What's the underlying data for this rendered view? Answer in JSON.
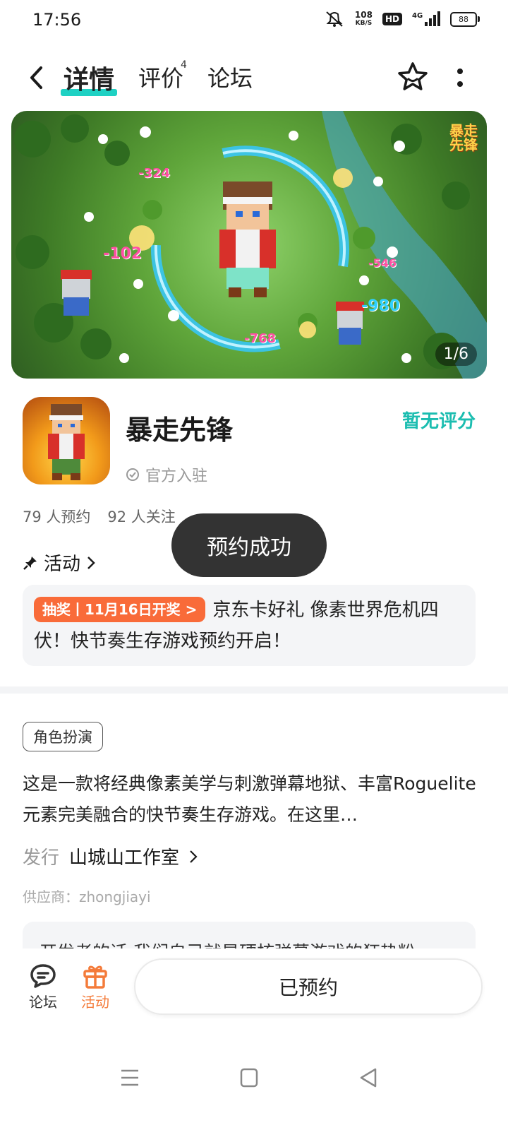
{
  "status_bar": {
    "time": "17:56",
    "net_speed_value": "108",
    "net_speed_unit": "KB/S",
    "hd": "HD",
    "network": "4G",
    "battery": "88"
  },
  "nav": {
    "tabs": [
      {
        "label": "详情",
        "active": true
      },
      {
        "label": "评价",
        "badge": "4"
      },
      {
        "label": "论坛"
      }
    ]
  },
  "banner": {
    "page_indicator": "1/6",
    "logo_text_line1": "暴走",
    "logo_text_line2": "先锋",
    "damage_numbers": [
      "-324",
      "-102",
      "-546",
      "-980",
      "-768"
    ]
  },
  "app": {
    "name": "暴走先锋",
    "official": "官方入驻",
    "rating": "暂无评分",
    "reservations": "79 人预约",
    "followers": "92 人关注"
  },
  "toast": {
    "text": "预约成功"
  },
  "activity": {
    "title": "活动",
    "badge": "抽奖丨11月16日开奖 >",
    "text": "京东卡好礼 像素世界危机四伏！快节奏生存游戏预约开启！"
  },
  "details": {
    "genre": "角色扮演",
    "description": "这是一款将经典像素美学与刺激弹幕地狱、丰富Roguelite元素完美融合的快节奏生存游戏。在这里…",
    "publisher_label": "发行",
    "publisher": "山城山工作室",
    "supplier": "供应商：zhongjiayi",
    "developer_note": "开发者的话 我们自己就是硬核弹幕游戏的狂热粉"
  },
  "bottom_bar": {
    "forum_label": "论坛",
    "activity_label": "活动",
    "reserve_button": "已预约"
  },
  "colors": {
    "accent": "#1ed1c3",
    "rating": "#1bbdb0",
    "orange": "#f96b39"
  }
}
